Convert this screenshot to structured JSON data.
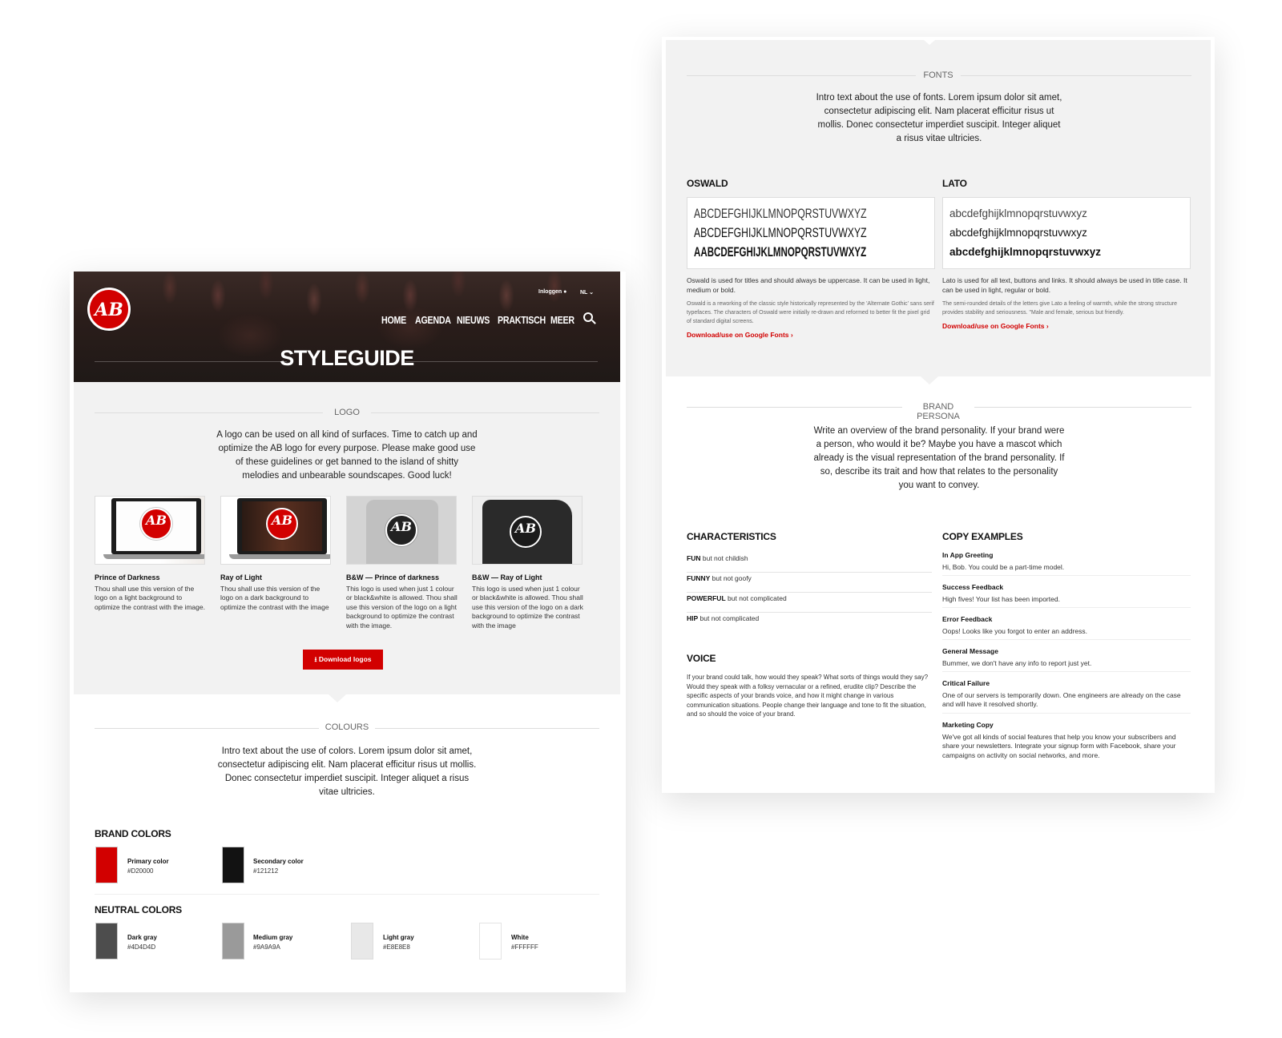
{
  "left_page": {
    "header": {
      "login": "Inloggen",
      "lang": "NL",
      "nav": [
        "HOME",
        "AGENDA",
        "NIEUWS",
        "PRAKTISCH",
        "MEER"
      ],
      "title": "STYLEGUIDE",
      "logo_text": "AB"
    },
    "logo_section": {
      "heading": "LOGO",
      "intro": "A logo can be used on all kind of surfaces. Time to catch up and optimize the AB logo for every purpose. Please make good use of these guidelines or get banned to the island of shitty melodies and unbearable soundscapes. Good luck!",
      "items": [
        {
          "title": "Prince of Darkness",
          "text": "Thou shall use this version of the logo on a light background to optimize the contrast with the image."
        },
        {
          "title": "Ray of Light",
          "text": "Thou shall use this version of the logo on a dark background to optimize the contrast with the image"
        },
        {
          "title": "B&W — Prince of darkness",
          "text": "This logo is used when just 1 colour or black&white is allowed. Thou shall use this version of the logo on a light background to optimize the contrast with the image."
        },
        {
          "title": "B&W — Ray of Light",
          "text": "This logo is used when just 1 colour or black&white is allowed. Thou shall use this version of the logo on a dark background to optimize the contrast with the image"
        }
      ],
      "download": "Download logos"
    },
    "colours_section": {
      "heading": "COLOURS",
      "intro": "Intro text about the use of colors. Lorem ipsum dolor sit amet, consectetur adipiscing elit. Nam placerat efficitur risus ut mollis. Donec consectetur imperdiet suscipit. Integer aliquet a risus vitae ultricies.",
      "brand_title": "BRAND COLORS",
      "brand": [
        {
          "name": "Primary color",
          "hex": "#D20000",
          "color": "#D20000"
        },
        {
          "name": "Secondary color",
          "hex": "#121212",
          "color": "#121212"
        }
      ],
      "neutral_title": "NEUTRAL COLORS",
      "neutral": [
        {
          "name": "Dark gray",
          "hex": "#4D4D4D",
          "color": "#4D4D4D"
        },
        {
          "name": "Medium gray",
          "hex": "#9A9A9A",
          "color": "#9A9A9A"
        },
        {
          "name": "Light gray",
          "hex": "#E8E8E8",
          "color": "#E8E8E8"
        },
        {
          "name": "White",
          "hex": "#FFFFFF",
          "color": "#FFFFFF"
        }
      ]
    }
  },
  "right_page": {
    "fonts_section": {
      "heading": "FONTS",
      "intro": "Intro text about the use of fonts. Lorem ipsum dolor sit amet, consectetur adipiscing elit. Nam placerat efficitur risus ut mollis. Donec consectetur imperdiet suscipit. Integer aliquet a risus vitae ultricies.",
      "oswald": {
        "name": "OSWALD",
        "sample": "ABCDEFGHIJKLMNOPQRSTUVWXYZ",
        "desc": "Oswald is used for titles and should always be uppercase. It can be used in light, medium or bold.",
        "detail": "Oswald is a reworking of the classic style historically represented by the 'Alternate Gothic' sans serif typefaces. The characters of Oswald were initially re-drawn and reformed to better fit the pixel grid of standard digital screens.",
        "link": "Download/use on Google Fonts"
      },
      "lato": {
        "name": "LATO",
        "sample": "abcdefghijklmnopqrstuvwxyz",
        "desc": "Lato is used for all text, buttons and links. It should always be used in title case. It can be used in light, regular or bold.",
        "detail": "The semi-rounded details of the letters give Lato a feeling of warmth, while the strong structure provides stability and seriousness. \"Male and female, serious but friendly.",
        "link": "Download/use on Google Fonts"
      }
    },
    "persona_section": {
      "heading": "BRAND PERSONA",
      "intro": "Write an overview of the brand personality. If your brand were a person, who would it be? Maybe you have a mascot which already is the visual representation of the brand personality. If so, describe its trait and how that relates to the personality you want to convey.",
      "characteristics_title": "CHARACTERISTICS",
      "characteristics": [
        {
          "key": "FUN",
          "rest": "but not childish"
        },
        {
          "key": "FUNNY",
          "rest": "but not goofy"
        },
        {
          "key": "POWERFUL",
          "rest": "but not complicated"
        },
        {
          "key": "HIP",
          "rest": "but not complicated"
        }
      ],
      "voice_title": "VOICE",
      "voice": "If your brand could talk, how would they speak? What sorts of things would they say? Would they speak with a folksy vernacular or a refined, erudite clip? Describe the specific aspects of your brands voice, and how it might change in various communication situations. People change their language and tone to fit the situation, and so should the voice of your brand.",
      "copy_title": "COPY EXAMPLES",
      "copy": [
        {
          "title": "In App Greeting",
          "text": "Hi, Bob. You could be a part-time model."
        },
        {
          "title": "Success Feedback",
          "text": "High fives! Your list has been imported."
        },
        {
          "title": "Error Feedback",
          "text": "Oops! Looks like you forgot to enter an address."
        },
        {
          "title": "General Message",
          "text": "Bummer, we don't have any info to report just yet."
        },
        {
          "title": "Critical Failure",
          "text": "One of our servers is temporarily down. One engineers are already on the case and will have it resolved shortly."
        },
        {
          "title": "Marketing Copy",
          "text": "We've got all kinds of social features that help you know your subscribers and share your newsletters. Integrate your signup form with Facebook, share your campaigns on activity on social networks, and more."
        }
      ]
    }
  }
}
